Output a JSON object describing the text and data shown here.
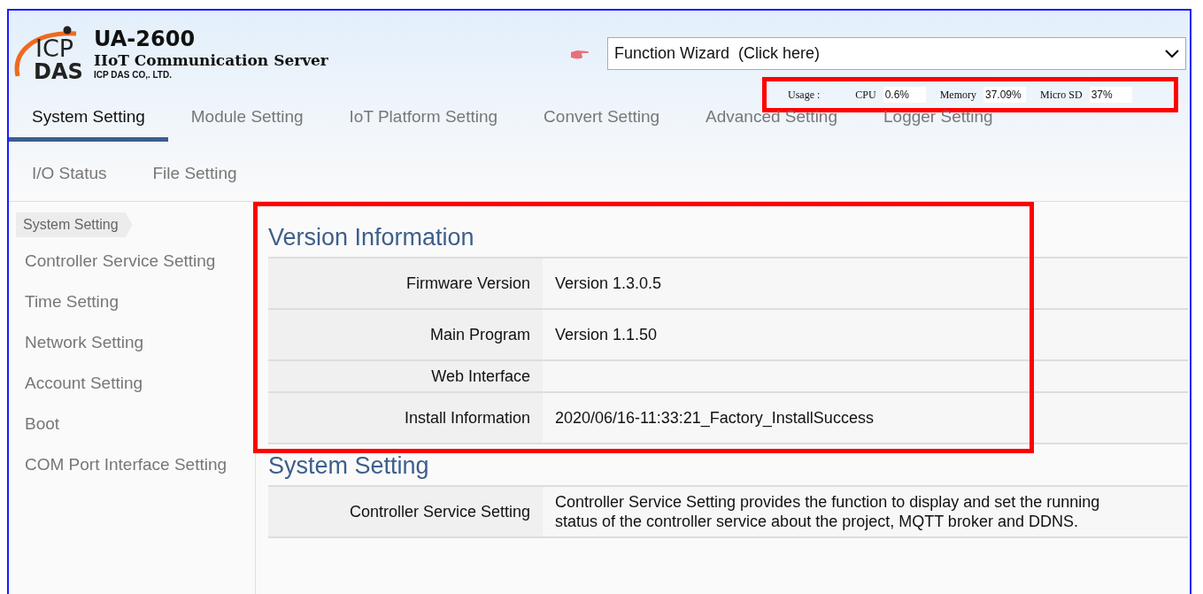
{
  "header": {
    "product": "UA-2600",
    "subtitle": "IIoT Communication Server",
    "company": "ICP DAS CO,. LTD.",
    "logo_top": "ICP",
    "logo_bottom": "DAS"
  },
  "wizard": {
    "value": "Function Wizard  (Click here)"
  },
  "usage": {
    "label": "Usage :",
    "items": [
      {
        "name": "CPU",
        "value": "0.6%"
      },
      {
        "name": "Memory",
        "value": "37.09%"
      },
      {
        "name": "Micro SD",
        "value": "37%"
      }
    ]
  },
  "tabs": [
    {
      "label": "System Setting",
      "selected": true
    },
    {
      "label": "Module Setting",
      "selected": false
    },
    {
      "label": "IoT Platform Setting",
      "selected": false
    },
    {
      "label": "Convert Setting",
      "selected": false
    },
    {
      "label": "Advanced Setting",
      "selected": false
    },
    {
      "label": "Logger Setting",
      "selected": false
    },
    {
      "label": "I/O Status",
      "selected": false
    },
    {
      "label": "File Setting",
      "selected": false
    }
  ],
  "breadcrumb": "System Setting",
  "sidebar": {
    "items": [
      "Controller Service Setting",
      "Time Setting",
      "Network Setting",
      "Account Setting",
      "Boot",
      "COM Port Interface Setting"
    ]
  },
  "sections": [
    {
      "title": "Version Information",
      "highlighted": true,
      "rows": [
        {
          "label": "Firmware Version",
          "value": "Version 1.3.0.5"
        },
        {
          "label": "Main Program",
          "value": "Version 1.1.50"
        },
        {
          "label": "Web Interface"
        },
        {
          "label": "Install Information",
          "value": "2020/06/16-11:33:21_Factory_InstallSuccess"
        }
      ]
    },
    {
      "title": "System Setting",
      "highlighted": false,
      "rows": [
        {
          "label": "Controller Service Setting",
          "value": "Controller Service Setting provides the function to display and set the running status of the controller service about the project, MQTT broker and DDNS."
        }
      ]
    }
  ]
}
